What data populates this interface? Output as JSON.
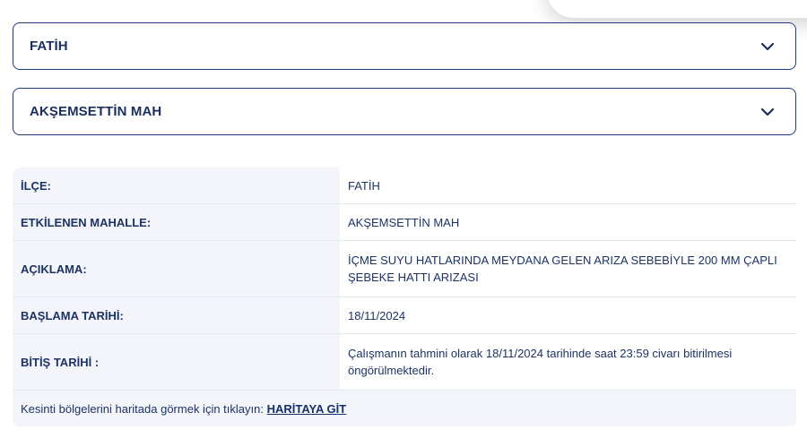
{
  "filters": {
    "district": {
      "selected": "FATİH",
      "icon": "chevron-down-icon"
    },
    "neighborhood": {
      "selected": "AKŞEMSETTİN MAH",
      "icon": "chevron-down-icon"
    }
  },
  "details": {
    "rows": [
      {
        "label": "İLÇE:",
        "value": "FATİH"
      },
      {
        "label": "ETKİLENEN MAHALLE:",
        "value": "AKŞEMSETTİN MAH"
      },
      {
        "label": "AÇIKLAMA:",
        "value": "İÇME SUYU HATLARINDA MEYDANA GELEN ARIZA SEBEBİYLE 200 MM ÇAPLI ŞEBEKE HATTI ARIZASI"
      },
      {
        "label": "BAŞLAMA TARİHİ:",
        "value": "18/11/2024"
      },
      {
        "label": "BİTİŞ TARİHİ :",
        "value": "Çalışmanın tahmini olarak 18/11/2024 tarihinde saat 23:59 civarı bitirilmesi öngörülmektedir."
      }
    ],
    "map_prompt": "Kesinti bölgelerini haritada görmek için tıklayın:",
    "map_link": "HARİTAYA GİT"
  },
  "colors": {
    "border": "#1f3c78",
    "text": "#1d3366",
    "label_bg": "#f3f5fa",
    "value_bg": "#ffffff"
  }
}
